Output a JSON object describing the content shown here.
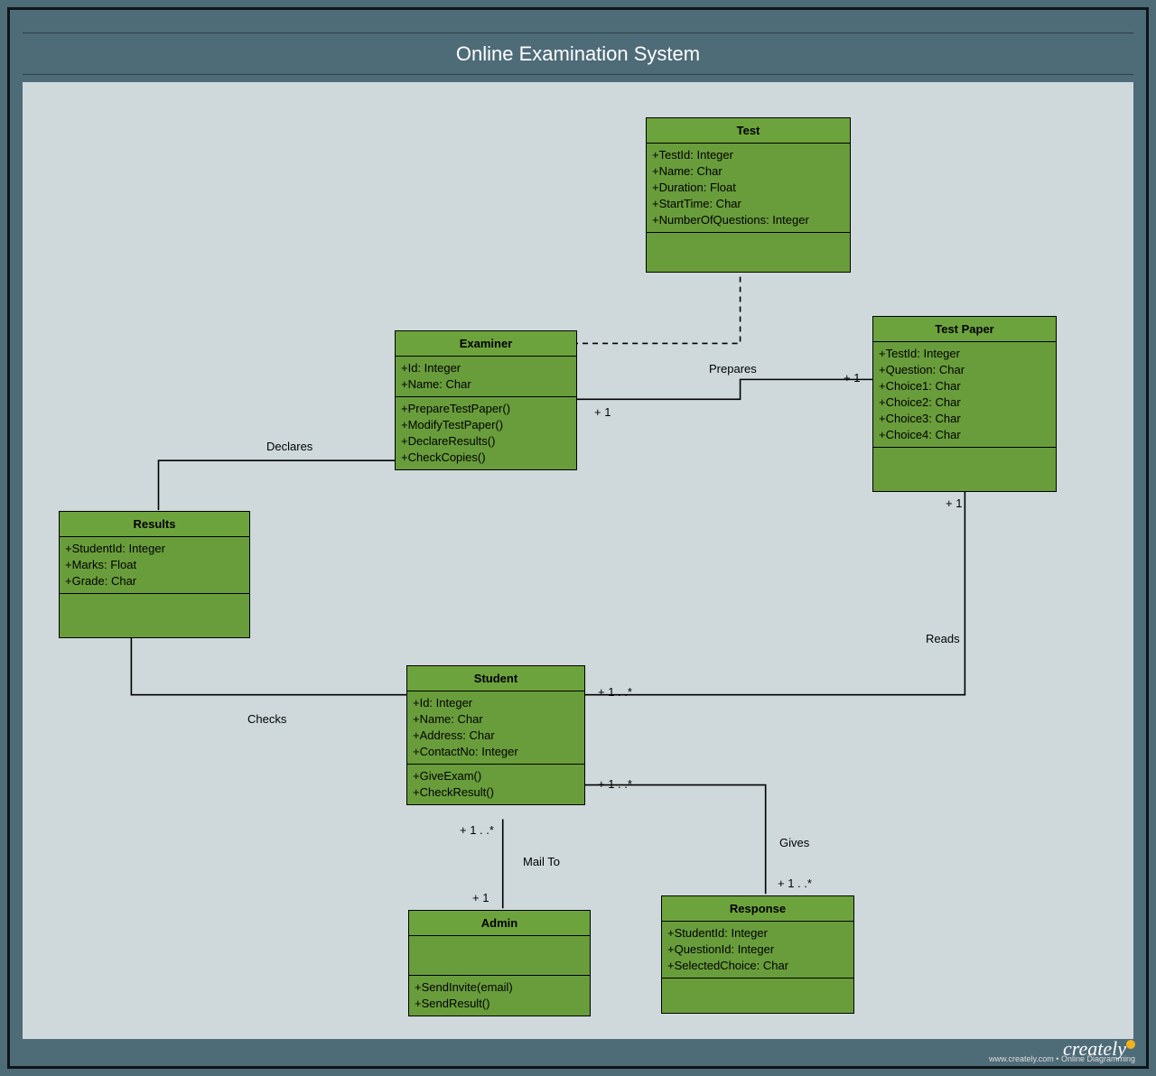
{
  "title": "Online Examination System",
  "classes": {
    "test": {
      "name": "Test",
      "attrs": [
        "+TestId: Integer",
        "+Name: Char",
        "+Duration: Float",
        "+StartTime: Char",
        "+NumberOfQuestions: Integer"
      ],
      "ops": []
    },
    "examiner": {
      "name": "Examiner",
      "attrs": [
        "+Id: Integer",
        "+Name: Char"
      ],
      "ops": [
        "+PrepareTestPaper()",
        "+ModifyTestPaper()",
        "+DeclareResults()",
        "+CheckCopies()"
      ]
    },
    "testpaper": {
      "name": "Test Paper",
      "attrs": [
        "+TestId: Integer",
        "+Question: Char",
        "+Choice1: Char",
        "+Choice2: Char",
        "+Choice3: Char",
        "+Choice4: Char"
      ],
      "ops": []
    },
    "results": {
      "name": "Results",
      "attrs": [
        "+StudentId: Integer",
        "+Marks: Float",
        "+Grade: Char"
      ],
      "ops": []
    },
    "student": {
      "name": "Student",
      "attrs": [
        "+Id: Integer",
        "+Name: Char",
        "+Address: Char",
        "+ContactNo: Integer"
      ],
      "ops": [
        "+GiveExam()",
        "+CheckResult()"
      ]
    },
    "admin": {
      "name": "Admin",
      "attrs": [],
      "ops": [
        "+SendInvite(email)",
        "+SendResult()"
      ]
    },
    "response": {
      "name": "Response",
      "attrs": [
        "+StudentId: Integer",
        "+QuestionId: Integer",
        "+SelectedChoice: Char"
      ],
      "ops": []
    }
  },
  "labels": {
    "declares": "Declares",
    "prepares": "Prepares",
    "reads": "Reads",
    "checks": "Checks",
    "mailto": "Mail To",
    "gives": "Gives",
    "one_a": "+ 1",
    "one_b": "+ 1",
    "one_c": "+ 1",
    "one_d": "+ 1",
    "many_a": "+ 1 . .*",
    "many_b": "+ 1 . .*",
    "many_c": "+ 1 . .*",
    "many_d": "+ 1 . .*"
  },
  "footer": {
    "brand": "creately",
    "sub": "www.creately.com • Online Diagramming"
  }
}
